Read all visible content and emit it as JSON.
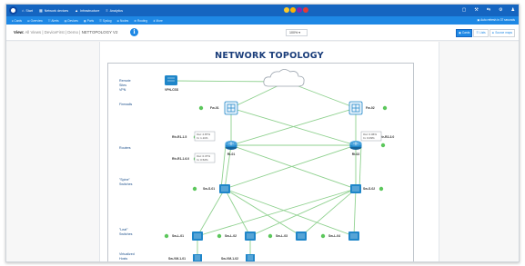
{
  "topbar": {
    "nav": [
      {
        "icon": "home-icon",
        "glyph": "⌂",
        "label": "Start"
      },
      {
        "icon": "network-icon",
        "glyph": "▦",
        "label": "Network devices"
      },
      {
        "icon": "alert-icon",
        "glyph": "▲",
        "label": "Infrastructure"
      },
      {
        "icon": "chart-icon",
        "glyph": "≡",
        "label": "Analytics"
      }
    ],
    "status_dots": [
      "#ffca28",
      "#ffb300",
      "#8e24aa",
      "#e53935"
    ],
    "right_icons": [
      {
        "name": "document-icon",
        "glyph": "▢"
      },
      {
        "name": "wrench-icon",
        "glyph": "⚒"
      },
      {
        "name": "share-icon",
        "glyph": "⇆"
      },
      {
        "name": "settings-icon",
        "glyph": "⚙"
      },
      {
        "name": "user-icon",
        "glyph": "♟"
      }
    ]
  },
  "subbar": {
    "items": [
      "♦ Cards",
      "⊞ Overview",
      "☷ Alerts",
      "▤ Devices",
      "▦ Ports",
      "☰ Syslog",
      "⊕ Nodes",
      "⚙ Routing",
      "⬇ More"
    ],
    "refresh": "▣ Auto refresh in 37 seconds"
  },
  "viewbar": {
    "view_label": "View:",
    "crumbs": [
      "All Views",
      "DeviceFirst",
      "Demo",
      "NETTOPOLOGY V2"
    ],
    "zoom": "100% ▾",
    "buttons": [
      "▣ Cards",
      "☰ Lists",
      "⊕ Source maps"
    ]
  },
  "diagram": {
    "title": "NETWORK TOPOLOGY",
    "rows": [
      {
        "lines": [
          "Remote",
          "Sites",
          "VPN"
        ]
      },
      {
        "lines": [
          "Firewalls"
        ]
      },
      {
        "lines": [
          "Routers"
        ]
      },
      {
        "lines": [
          "\"Spine\"",
          "Switches"
        ]
      },
      {
        "lines": [
          "\"Leaf\"",
          "Switches"
        ]
      },
      {
        "lines": [
          "Virtualized",
          "Hosts"
        ]
      }
    ],
    "nodes": {
      "vpn": "VPN-CSS",
      "fw1": "Fw-01",
      "fw2": "Fw-02",
      "rt1": "Rt-01",
      "rt2": "Rt-02",
      "rt_peer_a1": "Rtr-R1-1.5",
      "rt_peer_a2": "Rtr-R1-1.6.0",
      "rt_peer_b1": "Rtr-R2-3.0",
      "sp1": "Sw-S-01",
      "sp2": "Sw-S-02",
      "leafs": [
        "Sw-L-01",
        "Sw-L-02",
        "Sw-L-03",
        "Sw-L-04"
      ],
      "hosts": [
        "Sw-VM-1-01",
        "Sw-VM-1-02"
      ]
    },
    "stats": {
      "rt1_a": [
        "Out: 2.87%",
        "In: 1.11%"
      ],
      "rt1_b": [
        "Out: 0.37%",
        "In: 0.52%"
      ],
      "rt2_a": [
        "Out: 0.06%",
        "In: 0.09%"
      ]
    },
    "colors": {
      "link": "#8fd18f",
      "status_up": "#5cc75c",
      "device": "#1f86c9",
      "label": "#1a4e8a"
    }
  }
}
